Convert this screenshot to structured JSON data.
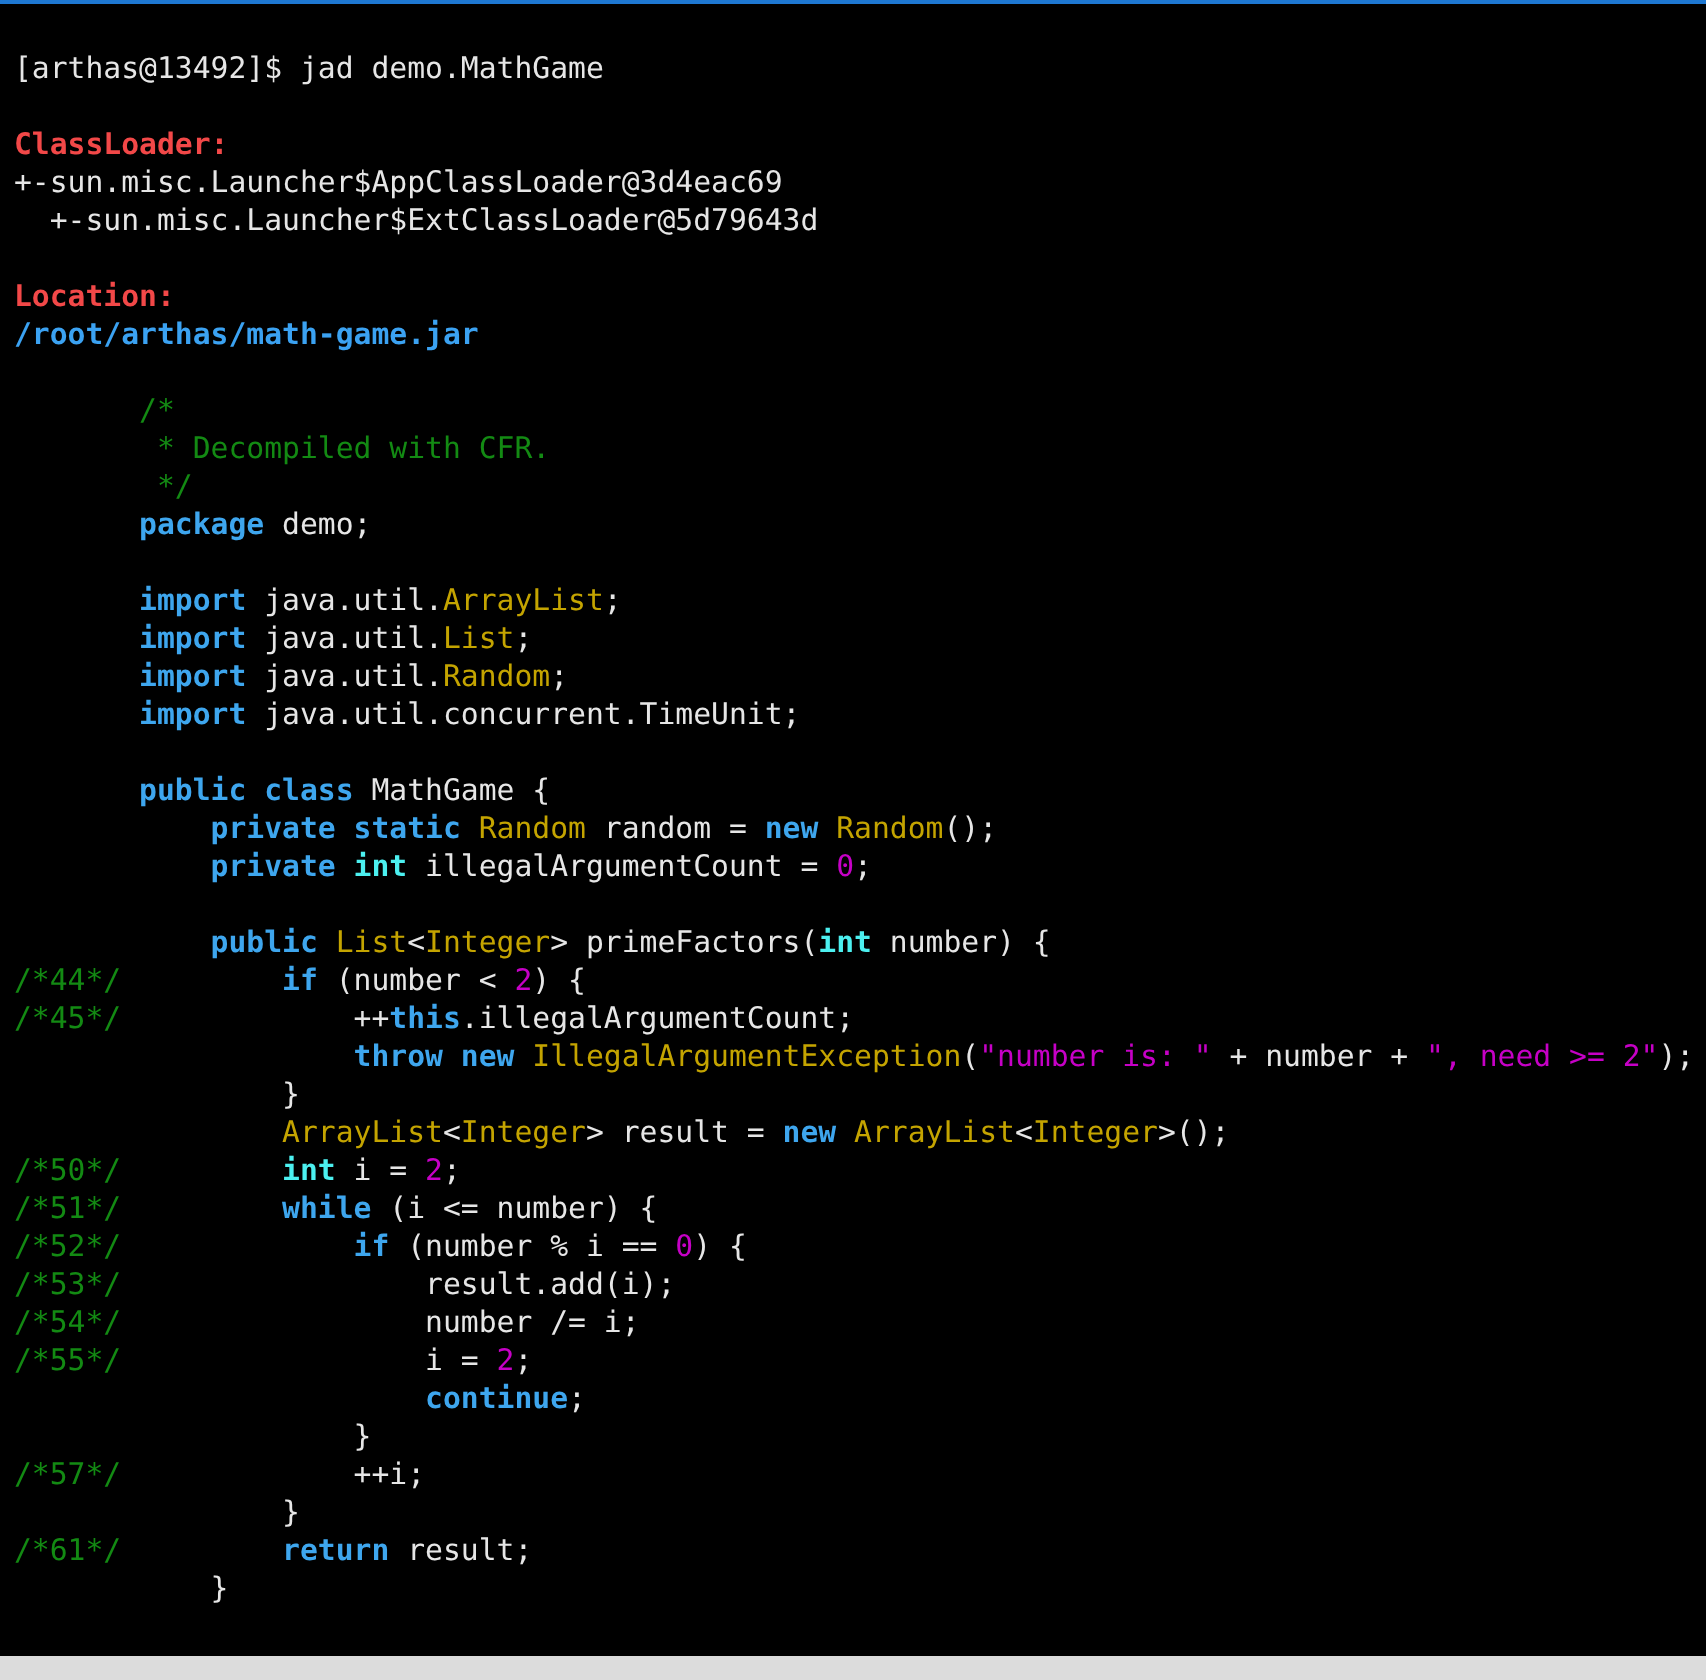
{
  "terminal": {
    "lines": [
      {
        "kind": "text",
        "segments": [
          {
            "kind": "plain",
            "text": "[arthas@13492]$ jad demo.MathGame"
          }
        ]
      },
      {
        "kind": "blank"
      },
      {
        "kind": "text",
        "segments": [
          {
            "kind": "label",
            "text": "ClassLoader:"
          }
        ]
      },
      {
        "kind": "text",
        "segments": [
          {
            "kind": "plain",
            "text": "+-sun.misc.Launcher$AppClassLoader@3d4eac69"
          }
        ]
      },
      {
        "kind": "text",
        "segments": [
          {
            "kind": "plain",
            "text": "  +-sun.misc.Launcher$ExtClassLoader@5d79643d"
          }
        ]
      },
      {
        "kind": "blank"
      },
      {
        "kind": "text",
        "segments": [
          {
            "kind": "label",
            "text": "Location:"
          }
        ]
      },
      {
        "kind": "text",
        "segments": [
          {
            "kind": "path",
            "text": "/root/arthas/math-game.jar"
          }
        ]
      },
      {
        "kind": "blank"
      },
      {
        "kind": "code",
        "segments": [
          {
            "kind": "comment",
            "text": "/*"
          }
        ]
      },
      {
        "kind": "code",
        "segments": [
          {
            "kind": "comment",
            "text": " * Decompiled with CFR."
          }
        ]
      },
      {
        "kind": "code",
        "segments": [
          {
            "kind": "comment",
            "text": " */"
          }
        ]
      },
      {
        "kind": "code",
        "segments": [
          {
            "kind": "keyword",
            "text": "package"
          },
          {
            "kind": "plain",
            "text": " demo;"
          }
        ]
      },
      {
        "kind": "blank"
      },
      {
        "kind": "code",
        "segments": [
          {
            "kind": "keyword",
            "text": "import"
          },
          {
            "kind": "plain",
            "text": " java.util."
          },
          {
            "kind": "type",
            "text": "ArrayList"
          },
          {
            "kind": "plain",
            "text": ";"
          }
        ]
      },
      {
        "kind": "code",
        "segments": [
          {
            "kind": "keyword",
            "text": "import"
          },
          {
            "kind": "plain",
            "text": " java.util."
          },
          {
            "kind": "type",
            "text": "List"
          },
          {
            "kind": "plain",
            "text": ";"
          }
        ]
      },
      {
        "kind": "code",
        "segments": [
          {
            "kind": "keyword",
            "text": "import"
          },
          {
            "kind": "plain",
            "text": " java.util."
          },
          {
            "kind": "type",
            "text": "Random"
          },
          {
            "kind": "plain",
            "text": ";"
          }
        ]
      },
      {
        "kind": "code",
        "segments": [
          {
            "kind": "keyword",
            "text": "import"
          },
          {
            "kind": "plain",
            "text": " java.util.concurrent.TimeUnit;"
          }
        ]
      },
      {
        "kind": "blank"
      },
      {
        "kind": "code",
        "segments": [
          {
            "kind": "keyword",
            "text": "public class"
          },
          {
            "kind": "plain",
            "text": " MathGame {"
          }
        ]
      },
      {
        "kind": "code",
        "segments": [
          {
            "kind": "keyword",
            "text": "    private static "
          },
          {
            "kind": "type",
            "text": "Random"
          },
          {
            "kind": "plain",
            "text": " random = "
          },
          {
            "kind": "keyword",
            "text": "new "
          },
          {
            "kind": "type",
            "text": "Random"
          },
          {
            "kind": "plain",
            "text": "();"
          }
        ]
      },
      {
        "kind": "code",
        "segments": [
          {
            "kind": "keyword",
            "text": "    private "
          },
          {
            "kind": "primitive",
            "text": "int"
          },
          {
            "kind": "plain",
            "text": " illegalArgumentCount = "
          },
          {
            "kind": "number",
            "text": "0"
          },
          {
            "kind": "plain",
            "text": ";"
          }
        ]
      },
      {
        "kind": "blank"
      },
      {
        "kind": "code",
        "segments": [
          {
            "kind": "keyword",
            "text": "    public "
          },
          {
            "kind": "type",
            "text": "List"
          },
          {
            "kind": "plain",
            "text": "<"
          },
          {
            "kind": "type",
            "text": "Integer"
          },
          {
            "kind": "plain",
            "text": "> primeFactors("
          },
          {
            "kind": "primitive",
            "text": "int"
          },
          {
            "kind": "plain",
            "text": " number) {"
          }
        ]
      },
      {
        "kind": "code",
        "gutter": "/*44*/",
        "segments": [
          {
            "kind": "keyword",
            "text": "        if"
          },
          {
            "kind": "plain",
            "text": " (number < "
          },
          {
            "kind": "number",
            "text": "2"
          },
          {
            "kind": "plain",
            "text": ") {"
          }
        ]
      },
      {
        "kind": "code",
        "gutter": "/*45*/",
        "segments": [
          {
            "kind": "plain",
            "text": "            ++"
          },
          {
            "kind": "keyword",
            "text": "this"
          },
          {
            "kind": "plain",
            "text": ".illegalArgumentCount;"
          }
        ]
      },
      {
        "kind": "code",
        "segments": [
          {
            "kind": "keyword",
            "text": "            throw new "
          },
          {
            "kind": "type",
            "text": "IllegalArgumentException"
          },
          {
            "kind": "plain",
            "text": "("
          },
          {
            "kind": "string",
            "text": "\"number is: \""
          },
          {
            "kind": "plain",
            "text": " + number + "
          },
          {
            "kind": "string",
            "text": "\", need >= 2\""
          },
          {
            "kind": "plain",
            "text": ");"
          }
        ]
      },
      {
        "kind": "code",
        "segments": [
          {
            "kind": "plain",
            "text": "        }"
          }
        ]
      },
      {
        "kind": "code",
        "segments": [
          {
            "kind": "type",
            "text": "        ArrayList"
          },
          {
            "kind": "plain",
            "text": "<"
          },
          {
            "kind": "type",
            "text": "Integer"
          },
          {
            "kind": "plain",
            "text": "> result = "
          },
          {
            "kind": "keyword",
            "text": "new "
          },
          {
            "kind": "type",
            "text": "ArrayList"
          },
          {
            "kind": "plain",
            "text": "<"
          },
          {
            "kind": "type",
            "text": "Integer"
          },
          {
            "kind": "plain",
            "text": ">();"
          }
        ]
      },
      {
        "kind": "code",
        "gutter": "/*50*/",
        "segments": [
          {
            "kind": "primitive",
            "text": "        int"
          },
          {
            "kind": "plain",
            "text": " i = "
          },
          {
            "kind": "number",
            "text": "2"
          },
          {
            "kind": "plain",
            "text": ";"
          }
        ]
      },
      {
        "kind": "code",
        "gutter": "/*51*/",
        "segments": [
          {
            "kind": "keyword",
            "text": "        while"
          },
          {
            "kind": "plain",
            "text": " (i <= number) {"
          }
        ]
      },
      {
        "kind": "code",
        "gutter": "/*52*/",
        "segments": [
          {
            "kind": "keyword",
            "text": "            if"
          },
          {
            "kind": "plain",
            "text": " (number % i == "
          },
          {
            "kind": "number",
            "text": "0"
          },
          {
            "kind": "plain",
            "text": ") {"
          }
        ]
      },
      {
        "kind": "code",
        "gutter": "/*53*/",
        "segments": [
          {
            "kind": "plain",
            "text": "                result.add(i);"
          }
        ]
      },
      {
        "kind": "code",
        "gutter": "/*54*/",
        "segments": [
          {
            "kind": "plain",
            "text": "                number /= i;"
          }
        ]
      },
      {
        "kind": "code",
        "gutter": "/*55*/",
        "segments": [
          {
            "kind": "plain",
            "text": "                i = "
          },
          {
            "kind": "number",
            "text": "2"
          },
          {
            "kind": "plain",
            "text": ";"
          }
        ]
      },
      {
        "kind": "code",
        "segments": [
          {
            "kind": "keyword",
            "text": "                continue"
          },
          {
            "kind": "plain",
            "text": ";"
          }
        ]
      },
      {
        "kind": "code",
        "segments": [
          {
            "kind": "plain",
            "text": "            }"
          }
        ]
      },
      {
        "kind": "code",
        "gutter": "/*57*/",
        "segments": [
          {
            "kind": "plain",
            "text": "            ++i;"
          }
        ]
      },
      {
        "kind": "code",
        "segments": [
          {
            "kind": "plain",
            "text": "        }"
          }
        ]
      },
      {
        "kind": "code",
        "gutter": "/*61*/",
        "segments": [
          {
            "kind": "keyword",
            "text": "        return"
          },
          {
            "kind": "plain",
            "text": " result;"
          }
        ]
      },
      {
        "kind": "code",
        "segments": [
          {
            "kind": "plain",
            "text": "    }"
          }
        ]
      }
    ]
  }
}
